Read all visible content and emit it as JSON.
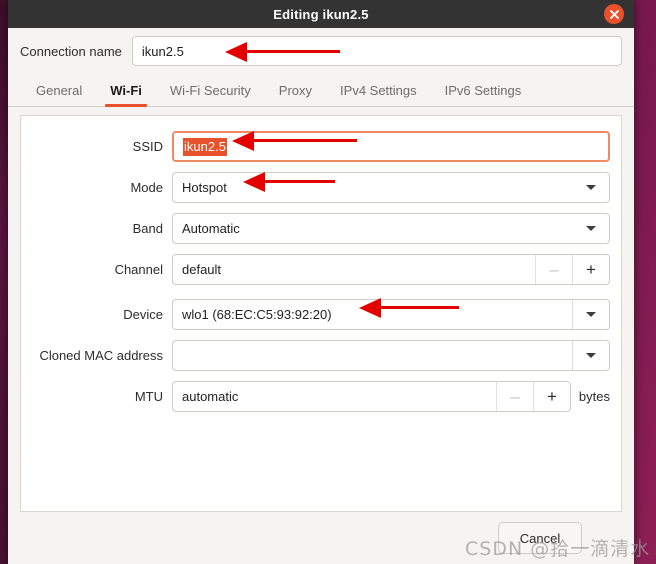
{
  "window": {
    "title": "Editing ikun2.5",
    "close_icon": "close-icon"
  },
  "connection": {
    "label": "Connection name",
    "value": "ikun2.5"
  },
  "tabs": [
    {
      "label": "General",
      "active": false
    },
    {
      "label": "Wi-Fi",
      "active": true
    },
    {
      "label": "Wi-Fi Security",
      "active": false
    },
    {
      "label": "Proxy",
      "active": false
    },
    {
      "label": "IPv4 Settings",
      "active": false
    },
    {
      "label": "IPv6 Settings",
      "active": false
    }
  ],
  "form": {
    "ssid": {
      "label": "SSID",
      "value": "ikun2.5"
    },
    "mode": {
      "label": "Mode",
      "value": "Hotspot"
    },
    "band": {
      "label": "Band",
      "value": "Automatic"
    },
    "channel": {
      "label": "Channel",
      "value": "default",
      "minus": "–",
      "plus": "+"
    },
    "device": {
      "label": "Device",
      "value": "wlo1 (68:EC:C5:93:92:20)"
    },
    "cloned_mac": {
      "label": "Cloned MAC address",
      "value": ""
    },
    "mtu": {
      "label": "MTU",
      "value": "automatic",
      "minus": "–",
      "plus": "+",
      "unit": "bytes"
    }
  },
  "footer": {
    "cancel_label": "Cancel"
  },
  "watermark": {
    "text": "CSDN @拾一滴清水"
  },
  "colors": {
    "accent": "#e8512a",
    "titlebar": "#333333",
    "window_bg": "#f5f4f3",
    "panel_bg": "#ffffff",
    "annotation": "#e50000",
    "desktop": "#5e1342"
  }
}
